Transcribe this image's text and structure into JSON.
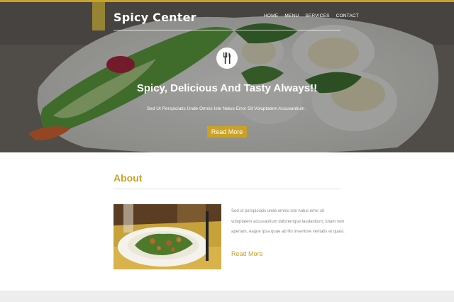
{
  "brand": {
    "name": "Spicy Center"
  },
  "nav": {
    "items": [
      {
        "label": "HOME"
      },
      {
        "label": "MENU"
      },
      {
        "label": "SERVICES"
      },
      {
        "label": "CONTACT"
      }
    ]
  },
  "hero": {
    "icon": "fork-knife-icon",
    "title": "Spicy, Delicious And Tasty Always!!",
    "subtitle": "Sed Ut Perspiciatis Unde Omnis Iste Natus Error Sit Voluptatem Accusantium .",
    "button_label": "Read More"
  },
  "about": {
    "title": "About",
    "text": "Sed ut perspiciatis unde omnis iste natus error sit voluptatem accusantium doloremque laudantium, totam rem aperiam, eaque ipsa quae ab illo inventore veritatis et quasi.",
    "link_label": "Read More"
  },
  "colors": {
    "accent": "#c9a227",
    "hero_overlay": "#3a3a3a",
    "text_muted": "#8a8a8a",
    "footer": "#ededed"
  }
}
